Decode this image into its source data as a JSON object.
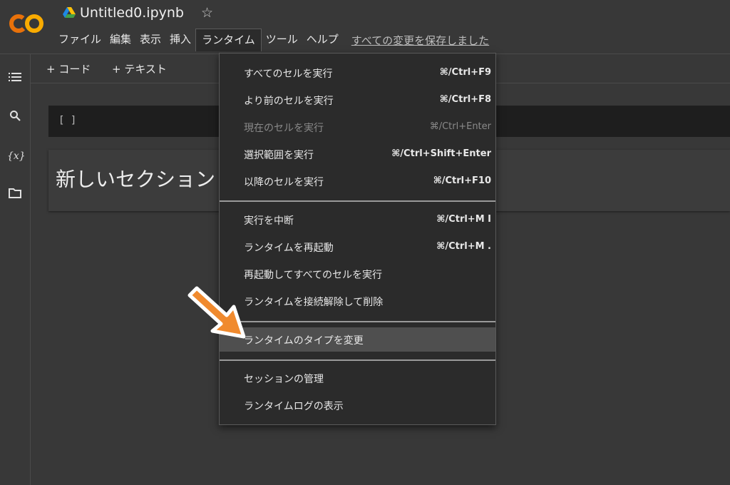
{
  "header": {
    "notebook_title": "Untitled0.ipynb",
    "menus": [
      "ファイル",
      "編集",
      "表示",
      "挿入",
      "ランタイム",
      "ツール",
      "ヘルプ"
    ],
    "save_status": "すべての変更を保存しました"
  },
  "toolbar": {
    "add_code": "+ コード",
    "add_text": "+ テキスト"
  },
  "cells": {
    "code_bracket": "[ ]",
    "section_title": "新しいセクション"
  },
  "runtime_menu": {
    "items": [
      {
        "label": "すべてのセルを実行",
        "shortcut": "⌘/Ctrl+F9"
      },
      {
        "label": "より前のセルを実行",
        "shortcut": "⌘/Ctrl+F8"
      },
      {
        "label": "現在のセルを実行",
        "shortcut": "⌘/Ctrl+Enter"
      },
      {
        "label": "選択範囲を実行",
        "shortcut": "⌘/Ctrl+Shift+Enter"
      },
      {
        "label": "以降のセルを実行",
        "shortcut": "⌘/Ctrl+F10"
      },
      {
        "label": "実行を中断",
        "shortcut": "⌘/Ctrl+M I"
      },
      {
        "label": "ランタイムを再起動",
        "shortcut": "⌘/Ctrl+M ."
      },
      {
        "label": "再起動してすべてのセルを実行",
        "shortcut": ""
      },
      {
        "label": "ランタイムを接続解除して削除",
        "shortcut": ""
      },
      {
        "label": "ランタイムのタイプを変更",
        "shortcut": ""
      },
      {
        "label": "セッションの管理",
        "shortcut": ""
      },
      {
        "label": "ランタイムログの表示",
        "shortcut": ""
      }
    ]
  },
  "colors": {
    "background": "#383838",
    "menu_bg": "#2b2b2b",
    "logo_orange": "#F9AB00",
    "logo_dark_orange": "#E8710A",
    "arrow_orange": "#F08A2E"
  },
  "icons": {
    "sidebar": [
      "toc-icon",
      "search-icon",
      "variables-icon",
      "folder-icon"
    ]
  }
}
